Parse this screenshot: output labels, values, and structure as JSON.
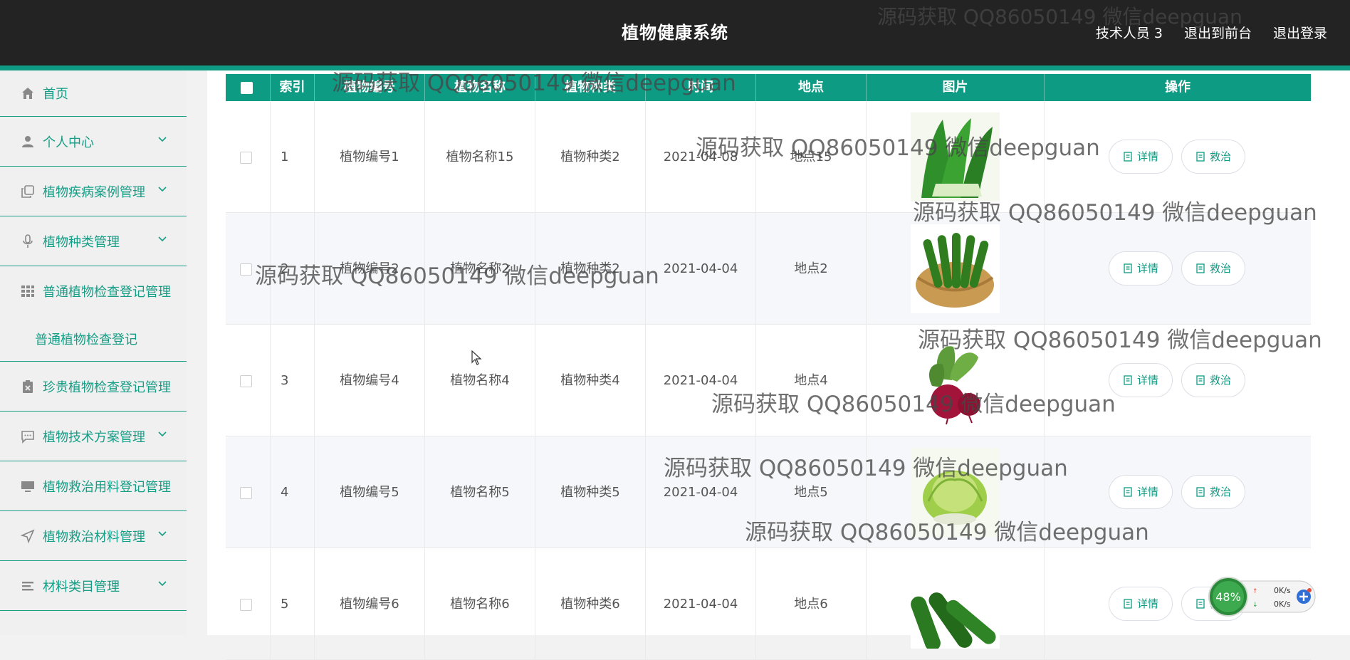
{
  "header": {
    "title": "植物健康系统",
    "links": [
      "技术人员 3",
      "退出到前台",
      "退出登录"
    ]
  },
  "sidebar": {
    "items": [
      {
        "label": "首页",
        "icon": "home-icon"
      },
      {
        "label": "个人中心",
        "icon": "user-icon"
      },
      {
        "label": "植物疾病案例管理",
        "icon": "copy-icon"
      },
      {
        "label": "植物种类管理",
        "icon": "microphone-icon"
      },
      {
        "label": "普通植物检查登记管理",
        "icon": "grid-icon"
      },
      {
        "label": "普通植物检查登记",
        "icon": ""
      },
      {
        "label": "珍贵植物检查登记管理",
        "icon": "clipboard-icon"
      },
      {
        "label": "植物技术方案管理",
        "icon": "chat-icon"
      },
      {
        "label": "植物救治用料登记管理",
        "icon": "monitor-icon"
      },
      {
        "label": "植物救治材料管理",
        "icon": "send-icon"
      },
      {
        "label": "材料类目管理",
        "icon": "list-icon"
      }
    ]
  },
  "table": {
    "columns": [
      "索引",
      "植物编号",
      "植物名称",
      "植物种类",
      "时间",
      "地点",
      "图片",
      "操作"
    ],
    "rows": [
      {
        "index": "1",
        "code": "植物编号1",
        "name": "植物名称15",
        "type": "植物种类2",
        "date": "2021-04-08",
        "place": "地点15",
        "image": "leafy-greens-photo"
      },
      {
        "index": "2",
        "code": "植物编号2",
        "name": "植物名称2",
        "type": "植物种类2",
        "date": "2021-04-04",
        "place": "地点2",
        "image": "cucumber-basket-photo"
      },
      {
        "index": "3",
        "code": "植物编号4",
        "name": "植物名称4",
        "type": "植物种类4",
        "date": "2021-04-04",
        "place": "地点4",
        "image": "beet-photo"
      },
      {
        "index": "4",
        "code": "植物编号5",
        "name": "植物名称5",
        "type": "植物种类5",
        "date": "2021-04-04",
        "place": "地点5",
        "image": "lettuce-photo"
      },
      {
        "index": "5",
        "code": "植物编号6",
        "name": "植物名称6",
        "type": "植物种类6",
        "date": "2021-04-04",
        "place": "地点6",
        "image": "cucumbers-photo"
      }
    ],
    "actions": {
      "detail": "详情",
      "treat": "救治"
    }
  },
  "watermark": "源码获取 QQ86050149 微信deepguan",
  "net_widget": {
    "percent": "48%",
    "upload": "0K/s",
    "download": "0K/s"
  },
  "colors": {
    "accent": "#0e9b84",
    "header_bg": "#232323"
  }
}
